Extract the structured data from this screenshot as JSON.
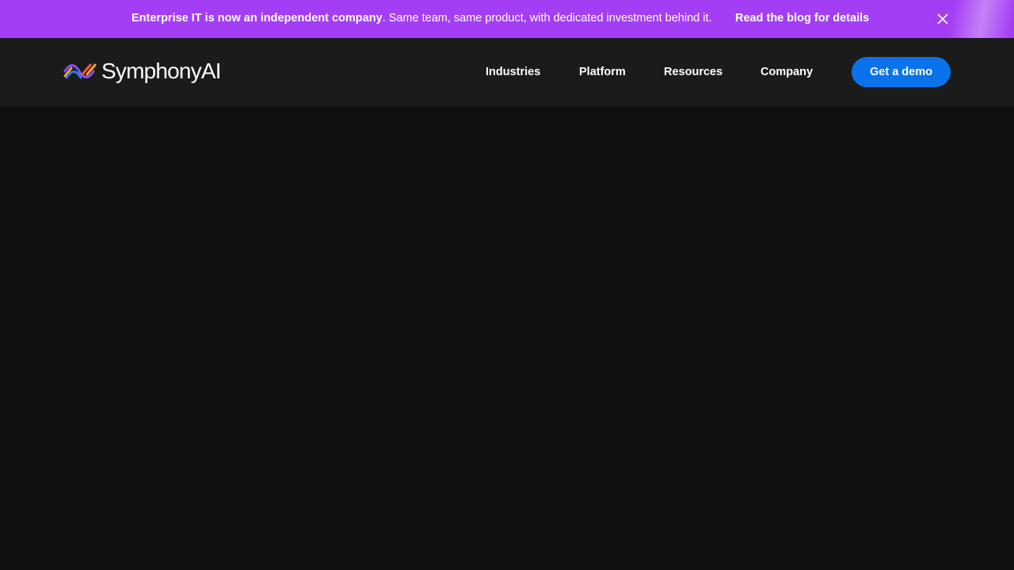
{
  "banner": {
    "strong_text": "Enterprise IT is now an independent company",
    "rest_text": ". Same team, same product, with dedicated investment behind it.",
    "link_label": "Read the blog for details",
    "close_icon": "close-icon",
    "background_color": "#a43ef4"
  },
  "header": {
    "logo_text": "SymphonyAI",
    "logo_icon": "symphonyai-logo-mark",
    "nav": {
      "industries": "Industries",
      "platform": "Platform",
      "resources": "Resources",
      "company": "Company"
    },
    "cta_label": "Get a demo",
    "cta_color": "#0a73eb",
    "background_color": "#1b1b1b"
  },
  "page": {
    "background_color": "#101010"
  }
}
